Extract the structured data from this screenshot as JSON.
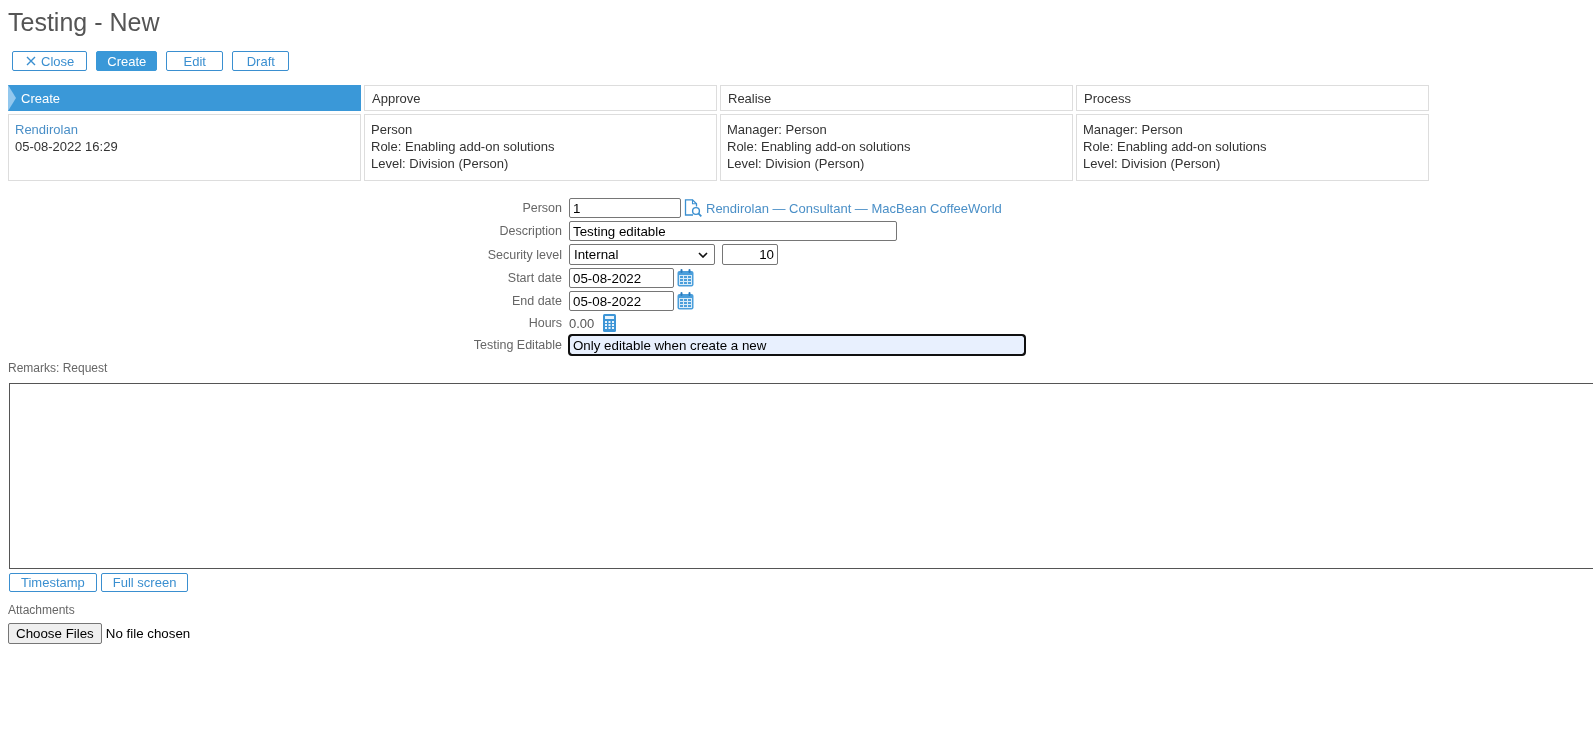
{
  "page": {
    "title": "Testing - New"
  },
  "toolbar": [
    {
      "label": "Close",
      "kind": "close"
    },
    {
      "label": "Create",
      "kind": "primary"
    },
    {
      "label": "Edit",
      "kind": "default"
    },
    {
      "label": "Draft",
      "kind": "default"
    }
  ],
  "workflow": [
    {
      "name": "Create",
      "selected": true,
      "lines": [
        {
          "text": "Rendirolan",
          "kind": "link"
        },
        {
          "text": "05-08-2022 16:29",
          "kind": "text"
        }
      ]
    },
    {
      "name": "Approve",
      "selected": false,
      "lines": [
        {
          "text": "Person",
          "kind": "text"
        },
        {
          "text": "Role: Enabling add-on solutions",
          "kind": "text"
        },
        {
          "text": "Level: Division (Person)",
          "kind": "text"
        }
      ]
    },
    {
      "name": "Realise",
      "selected": false,
      "lines": [
        {
          "text": "Manager: Person",
          "kind": "text"
        },
        {
          "text": "Role: Enabling add-on solutions",
          "kind": "text"
        },
        {
          "text": "Level: Division (Person)",
          "kind": "text"
        }
      ]
    },
    {
      "name": "Process",
      "selected": false,
      "lines": [
        {
          "text": "Manager: Person",
          "kind": "text"
        },
        {
          "text": "Role: Enabling add-on solutions",
          "kind": "text"
        },
        {
          "text": "Level: Division (Person)",
          "kind": "text"
        }
      ]
    }
  ],
  "form": [
    {
      "label": "Person",
      "kind": "lookup",
      "value": "1",
      "link": "Rendirolan — Consultant — MacBean CoffeeWorld",
      "focused": false
    },
    {
      "label": "Description",
      "kind": "text",
      "value": "Testing editable",
      "focused": false
    },
    {
      "label": "Security level",
      "kind": "select",
      "value": "Internal",
      "number": "10",
      "focused": false
    },
    {
      "label": "Start date",
      "kind": "date",
      "value": "05-08-2022",
      "focused": false
    },
    {
      "label": "End date",
      "kind": "date",
      "value": "05-08-2022",
      "focused": false
    },
    {
      "label": "Hours",
      "kind": "hours",
      "value": "0.00",
      "focused": false
    },
    {
      "label": "Testing Editable",
      "kind": "custom-text",
      "value": "Only editable when create a new",
      "focused": true
    }
  ],
  "remarks": {
    "label": "Remarks: Request",
    "buttons": [
      "Timestamp",
      "Full screen"
    ]
  },
  "attachments": {
    "label": "Attachments",
    "button": "Choose Files",
    "status": "No file chosen"
  }
}
